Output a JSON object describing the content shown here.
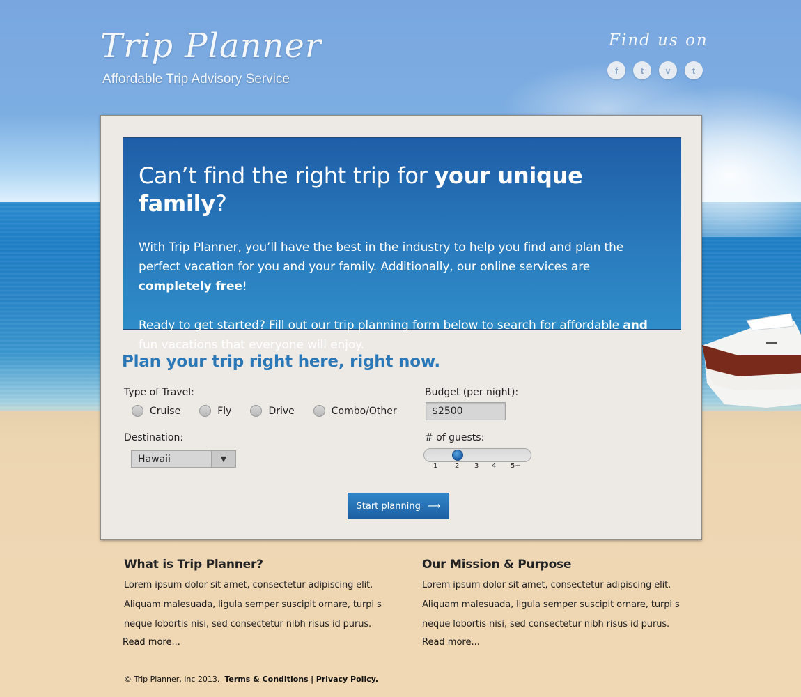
{
  "header": {
    "brand_title": "Trip Planner",
    "brand_tagline": "Affordable Trip Advisory Service",
    "find_us_label": "Find us on",
    "social": [
      {
        "icon": "facebook-icon",
        "glyph": "f"
      },
      {
        "icon": "twitter-icon",
        "glyph": "t"
      },
      {
        "icon": "vimeo-icon",
        "glyph": "v"
      },
      {
        "icon": "tumblr-icon",
        "glyph": "t"
      }
    ]
  },
  "hero": {
    "headline_pre": "Can’t find the right trip for ",
    "headline_bold": "your unique family",
    "headline_post": "?",
    "para1_pre": "With Trip Planner, you’ll have the best in the industry to help you find and plan the perfect vacation for you and your family.  Additionally, our online services are ",
    "para1_bold": "completely free",
    "para1_post": "!",
    "para2_pre": "Ready to get started?  Fill out our trip planning form below to search for affordable ",
    "para2_bold": "and",
    "para2_post": " fun vacations that everyone will enjoy."
  },
  "form": {
    "title": "Plan your trip right here, right now.",
    "travel_type_label": "Type of Travel:",
    "travel_options": [
      "Cruise",
      "Fly",
      "Drive",
      "Combo/Other"
    ],
    "budget_label": "Budget (per night):",
    "budget_value": "$2500",
    "destination_label": "Destination:",
    "destination_value": "Hawaii",
    "guests_label": "# of guests:",
    "guest_ticks": [
      "1",
      "2",
      "3",
      "4",
      "5+"
    ],
    "guests_selected": "2",
    "submit_label": "Start planning",
    "submit_arrow": "⟶"
  },
  "info": {
    "left": {
      "title": "What is Trip Planner?",
      "body": "Lorem ipsum dolor sit amet, consectetur adipiscing elit. Aliquam malesuada, ligula semper suscipit ornare, turpi s neque lobortis nisi, sed consectetur nibh risus id purus.",
      "read_more": "Read more..."
    },
    "right": {
      "title": "Our Mission & Purpose",
      "body": "Lorem ipsum dolor sit amet, consectetur adipiscing elit. Aliquam malesuada, ligula semper suscipit ornare, turpi s neque lobortis nisi, sed consectetur nibh risus id purus.",
      "read_more": "Read more..."
    }
  },
  "footer": {
    "copyright": "© Trip Planner, inc 2013.",
    "terms": "Terms & Conditions",
    "separator": "|",
    "privacy": "Privacy Policy."
  },
  "colors": {
    "accent": "#2a78b8",
    "hero_top": "#1f5ea8",
    "hero_bottom": "#2f8dc8",
    "sand": "#efd6b3",
    "panel": "#edeae6"
  }
}
